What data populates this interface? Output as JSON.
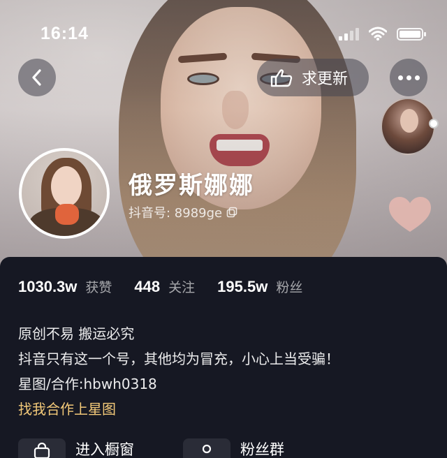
{
  "status_bar": {
    "time": "16:14"
  },
  "top_bar": {
    "update_label": "求更新"
  },
  "profile": {
    "name": "俄罗斯娜娜",
    "douyin_id": "抖音号: 8989ge"
  },
  "stats": [
    {
      "value": "1030.3w",
      "label": "获赞"
    },
    {
      "value": "448",
      "label": "关注"
    },
    {
      "value": "195.5w",
      "label": "粉丝"
    }
  ],
  "bio": {
    "lines": [
      "原创不易 搬运必究",
      "抖音只有这一个号，其他均为冒充，小心上当受骗！",
      "星图/合作:hbwh0318"
    ],
    "link": "找我合作上星图"
  },
  "entries": [
    {
      "label": "进入橱窗",
      "icon": "shop-bag-icon"
    },
    {
      "label": "粉丝群",
      "icon": "group-icon"
    }
  ],
  "colors": {
    "panel_bg": "#161823",
    "link": "#f3c979",
    "heart": "#e8b8b0"
  }
}
